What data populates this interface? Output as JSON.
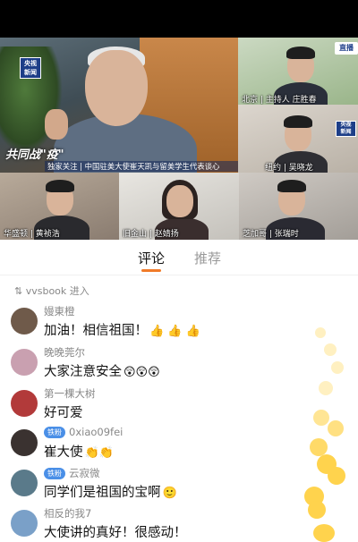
{
  "video": {
    "channel_logo": "央视\n新闻",
    "live_badge": "直播",
    "small_logo": "央视\n新闻",
    "campaign_title": "共同战\"疫\"",
    "banner_text": "独家关注 | 中国驻美大使崔天凯与留美学生代表谈心",
    "captions": [
      "北京 | 主持人 庄胜春",
      "纽约 | 吴晓龙",
      "华盛顿 | 黄祯浩",
      "旧金山 | 赵婧扬",
      "芝加哥 | 张瑞时"
    ]
  },
  "tabs": [
    {
      "label": "评论",
      "active": true
    },
    {
      "label": "推荐",
      "active": false
    }
  ],
  "enter_notice": "vvsbook 进入",
  "comments": [
    {
      "name": "嫚東橙",
      "badge": "",
      "text": "加油！相信祖国！",
      "emoji": "👍 👍 👍",
      "avatar_color": "#6f5a4a"
    },
    {
      "name": "晚晚莞尔",
      "badge": "",
      "text": "大家注意安全",
      "emoji": "😲😲😲",
      "avatar_color": "#c9a0b0"
    },
    {
      "name": "第一棵大树",
      "badge": "",
      "text": "好可爱",
      "emoji": "",
      "avatar_color": "#b23a3a"
    },
    {
      "name": "0xiao09fei",
      "badge": "铁粉",
      "text": "崔大使",
      "emoji": "👏👏",
      "avatar_color": "#3a3230"
    },
    {
      "name": "云寂微",
      "badge": "铁粉",
      "text": "同学们是祖国的宝啊",
      "emoji": "🙂",
      "avatar_color": "#5a7a8a"
    },
    {
      "name": "相反的我7",
      "badge": "",
      "text": "大使讲的真好！很感动！",
      "emoji": "",
      "avatar_color": "#7aa0c8"
    }
  ],
  "floating_emoji": "👍"
}
